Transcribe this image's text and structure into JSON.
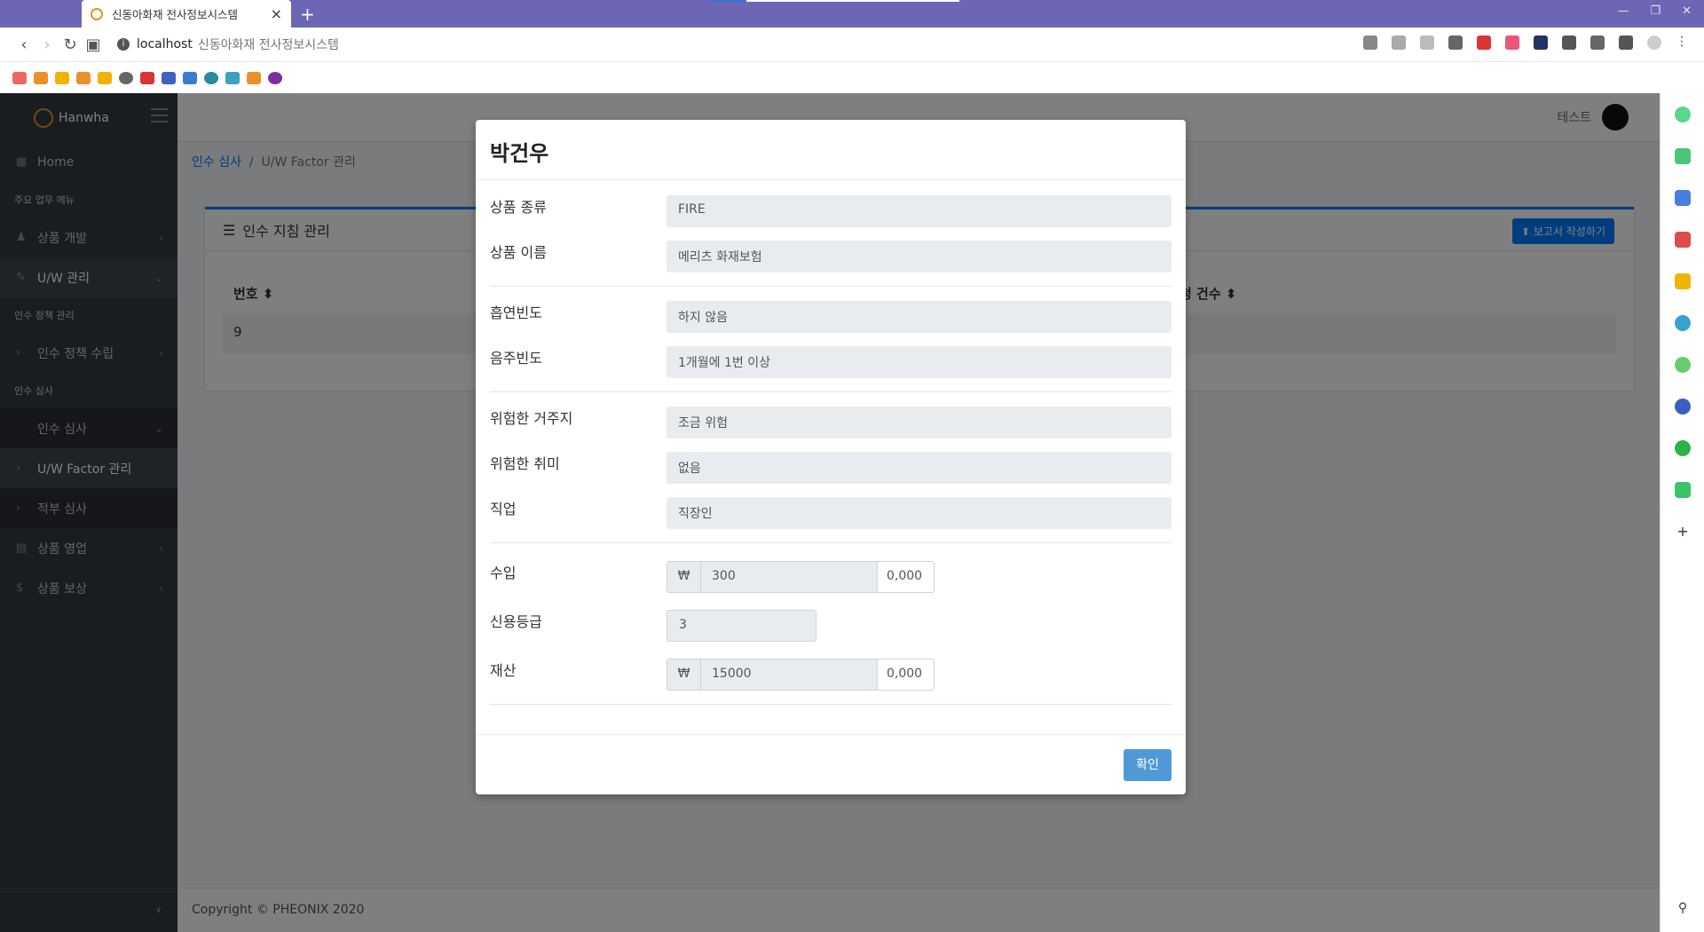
{
  "browser": {
    "tab_title": "신동아화재 전사정보시스템",
    "address_host": "localhost",
    "address_title": "신동아화재 전사정보시스템"
  },
  "app": {
    "brand": "Hanwha",
    "user_name": "테스트"
  },
  "sidebar": {
    "home": "Home",
    "section_main": "주요 업무 메뉴",
    "product_dev": "상품 개발",
    "uw_manage": "U/W 관리",
    "section_policy": "인수 정책 관리",
    "policy_setup": "인수 정책 수립",
    "section_review": "인수 심사",
    "review": "인수 심사",
    "uw_factor": "U/W Factor 관리",
    "suitability": "적부 심사",
    "product_sales": "상품 영업",
    "product_comp": "상품 보상"
  },
  "breadcrumb": {
    "parent": "인수 심사",
    "sep": "/",
    "current": "U/W Factor 관리"
  },
  "card": {
    "title": "인수 지침 관리",
    "report_button": "보고서 작성하기",
    "col_no": "번호",
    "col_count": "청 건수",
    "row_no": "9"
  },
  "modal": {
    "title": "박건우",
    "fields": {
      "product_type_label": "상품 종류",
      "product_type": "FIRE",
      "product_name_label": "상품 이름",
      "product_name": "메리츠 화재보험",
      "smoking_label": "흡연빈도",
      "smoking": "하지 않음",
      "drinking_label": "음주빈도",
      "drinking": "1개월에 1번 이상",
      "residence_label": "위험한 거주지",
      "residence": "조금 위험",
      "hobby_label": "위험한 취미",
      "hobby": "없음",
      "job_label": "직업",
      "job": "직장인",
      "income_label": "수입",
      "income_prefix": "₩",
      "income": "300",
      "income_suffix": "0,000",
      "credit_label": "신용등급",
      "credit": "3",
      "asset_label": "재산",
      "asset_prefix": "₩",
      "asset": "15000",
      "asset_suffix": "0,000"
    },
    "confirm_button": "확인"
  },
  "footer": {
    "copyright": "Copyright © PHEONIX 2020"
  }
}
